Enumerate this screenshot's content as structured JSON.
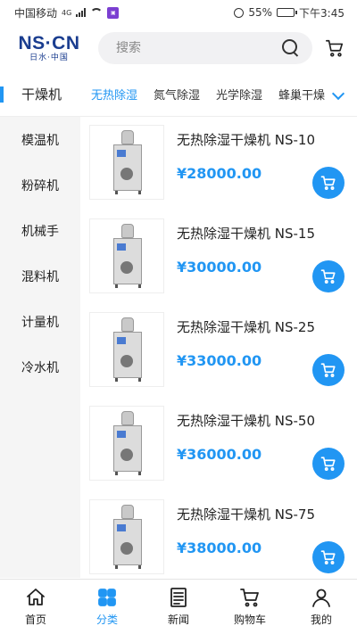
{
  "status_bar": {
    "carrier": "中国移动",
    "network": "4G",
    "battery": "55%",
    "battery_level": 0.55,
    "time": "下午3:45"
  },
  "header": {
    "logo_main": "NS·CN",
    "logo_sub": "日水·中国",
    "search_placeholder": "搜索"
  },
  "category_bar": {
    "current": "干燥机",
    "subtabs": [
      "无热除湿",
      "氮气除湿",
      "光学除湿",
      "蜂巢干燥"
    ],
    "active_index": 0
  },
  "sidebar": {
    "items": [
      "模温机",
      "粉碎机",
      "机械手",
      "混料机",
      "计量机",
      "冷水机"
    ]
  },
  "products": [
    {
      "name": "无热除湿干燥机 NS-10",
      "price": "¥28000.00"
    },
    {
      "name": "无热除湿干燥机 NS-15",
      "price": "¥30000.00"
    },
    {
      "name": "无热除湿干燥机 NS-25",
      "price": "¥33000.00"
    },
    {
      "name": "无热除湿干燥机 NS-50",
      "price": "¥36000.00"
    },
    {
      "name": "无热除湿干燥机 NS-75",
      "price": "¥38000.00"
    }
  ],
  "tabbar": {
    "items": [
      {
        "label": "首页",
        "icon": "home-icon"
      },
      {
        "label": "分类",
        "icon": "grid-icon"
      },
      {
        "label": "新闻",
        "icon": "news-icon"
      },
      {
        "label": "购物车",
        "icon": "cart-icon"
      },
      {
        "label": "我的",
        "icon": "user-icon"
      }
    ],
    "active_index": 1
  },
  "colors": {
    "accent": "#2196f3",
    "logo": "#1a3d8f",
    "sidebar_bg": "#f5f5f5"
  }
}
